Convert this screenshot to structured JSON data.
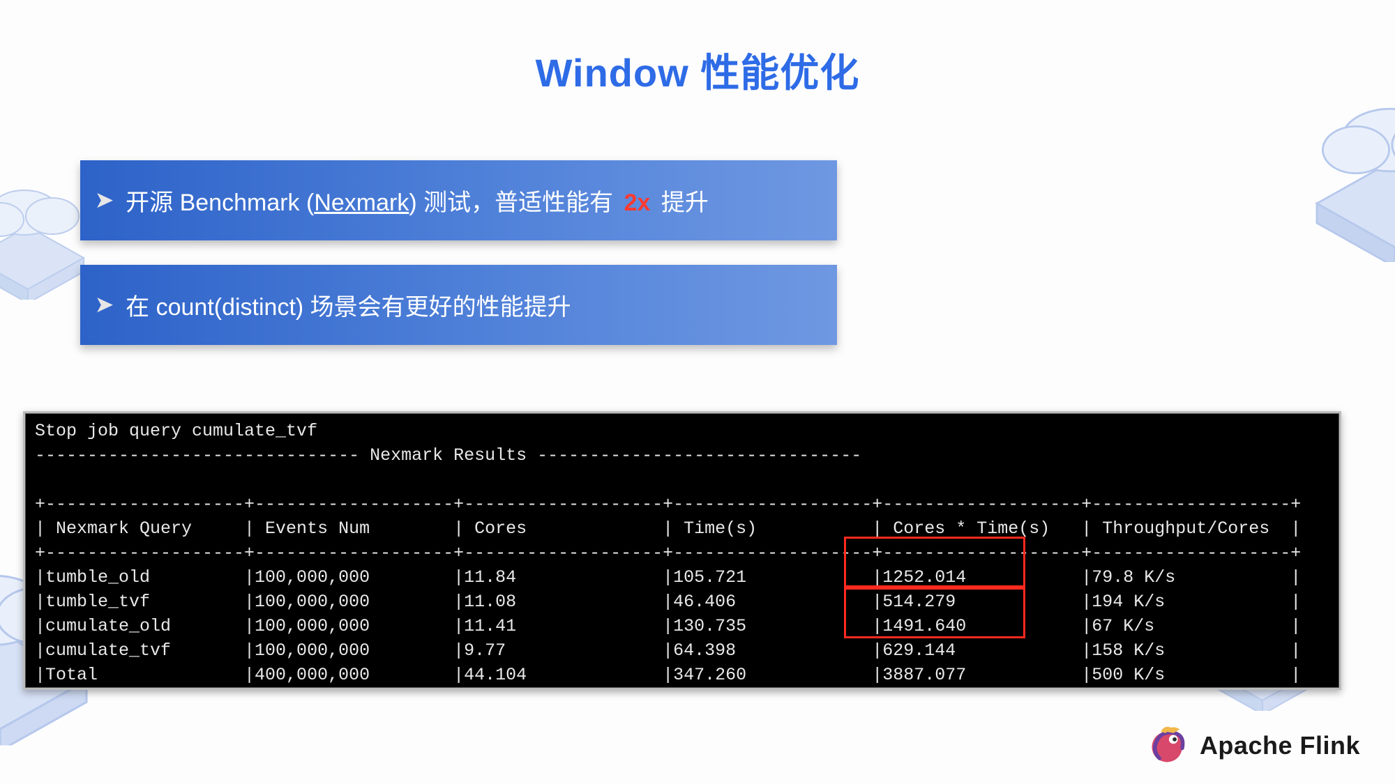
{
  "title": "Window 性能优化",
  "callouts": {
    "c1": {
      "prefix": "开源 Benchmark (",
      "link": "Nexmark",
      "mid": ") 测试，普适性能有 ",
      "highlight": "2x",
      "suffix": " 提升"
    },
    "c2": {
      "text": "在 count(distinct) 场景会有更好的性能提升"
    }
  },
  "chart_data": {
    "type": "table",
    "title": "Nexmark Results",
    "preamble": "Stop job query cumulate_tvf",
    "columns": [
      "Nexmark Query",
      "Events Num",
      "Cores",
      "Time(s)",
      "Cores * Time(s)",
      "Throughput/Cores"
    ],
    "rows": [
      {
        "query": "tumble_old",
        "events": "100,000,000",
        "cores": "11.84",
        "time": "105.721",
        "cores_time": "1252.014",
        "throughput": "79.8 K/s"
      },
      {
        "query": "tumble_tvf",
        "events": "100,000,000",
        "cores": "11.08",
        "time": "46.406",
        "cores_time": "514.279",
        "throughput": "194 K/s"
      },
      {
        "query": "cumulate_old",
        "events": "100,000,000",
        "cores": "11.41",
        "time": "130.735",
        "cores_time": "1491.640",
        "throughput": "67 K/s"
      },
      {
        "query": "cumulate_tvf",
        "events": "100,000,000",
        "cores": "9.77",
        "time": "64.398",
        "cores_time": "629.144",
        "throughput": "158 K/s"
      },
      {
        "query": "Total",
        "events": "400,000,000",
        "cores": "44.104",
        "time": "347.260",
        "cores_time": "3887.077",
        "throughput": "500 K/s"
      }
    ],
    "highlighted_cells": [
      [
        0,
        4
      ],
      [
        1,
        4
      ],
      [
        2,
        4
      ],
      [
        3,
        4
      ]
    ]
  },
  "footer": {
    "brand": "Apache Flink"
  }
}
